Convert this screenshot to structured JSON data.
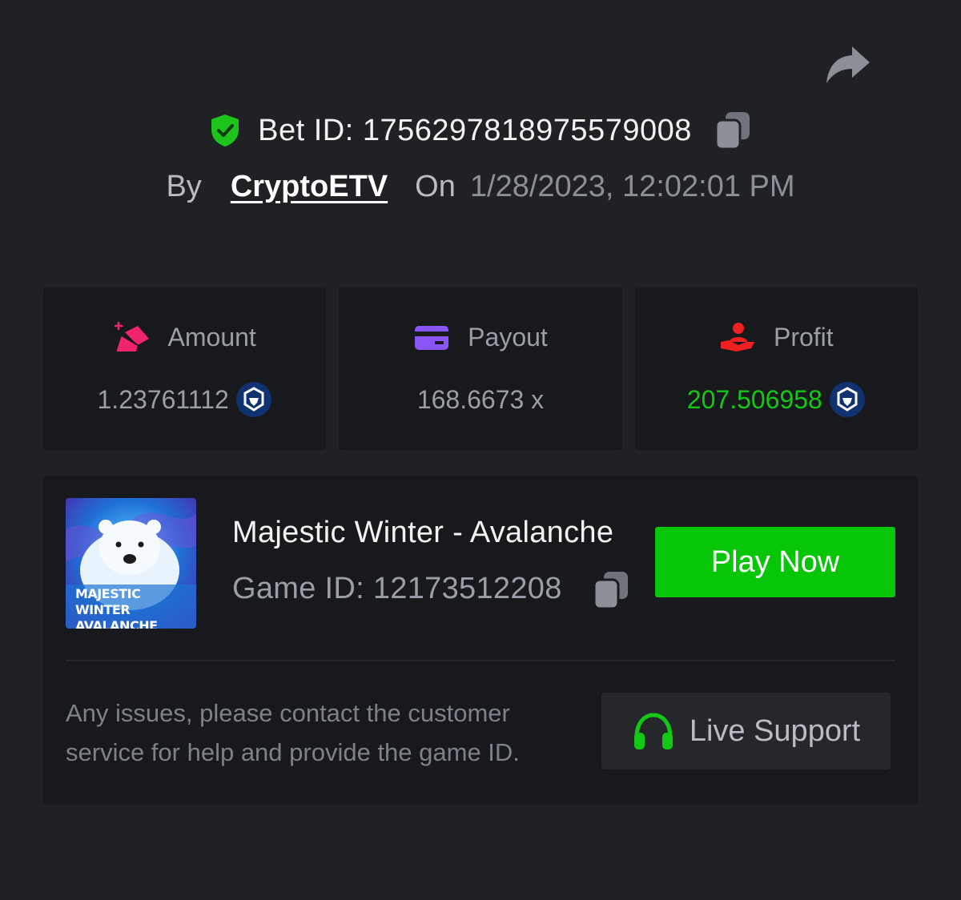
{
  "header": {
    "bet_label": "Bet ID: 1756297818975579008",
    "by_word": "By",
    "username": "CryptoETV",
    "on_word": "On",
    "datetime": "1/28/2023, 12:02:01 PM"
  },
  "stats": {
    "amount": {
      "label": "Amount",
      "value": "1.23761112"
    },
    "payout": {
      "label": "Payout",
      "value": "168.6673 x"
    },
    "profit": {
      "label": "Profit",
      "value": "207.506958"
    }
  },
  "game": {
    "title": "Majestic Winter - Avalanche",
    "game_id_label": "Game ID: 12173512208",
    "thumbnail_text_line1": "MAJESTIC WINTER",
    "thumbnail_text_line2": "AVALANCHE",
    "play_label": "Play Now"
  },
  "support": {
    "help_text": "Any issues, please contact the customer service for help and provide the game ID.",
    "button_label": "Live Support"
  },
  "colors": {
    "background": "#202124",
    "card": "#18191c",
    "accent_green": "#07c507",
    "profit_green": "#12c814",
    "shield_green": "#1ec31b",
    "amount_icon": "#f0246e",
    "payout_icon": "#8a55f6",
    "profit_icon": "#ef2020",
    "coin_blue": "#103271"
  },
  "icons": {
    "share": "share-arrow-icon",
    "shield": "verified-shield-icon",
    "copy": "copy-icon",
    "amount": "gem-coins-icon",
    "payout": "card-icon",
    "profit": "hand-user-icon",
    "coin": "crypto-coin-icon",
    "support": "headphones-icon"
  }
}
